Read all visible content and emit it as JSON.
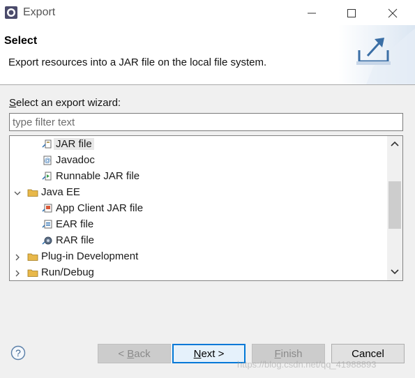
{
  "window": {
    "title": "Export",
    "controls": {
      "minimize_icon": "minimize-icon",
      "maximize_icon": "maximize-icon",
      "close_icon": "close-icon"
    }
  },
  "header": {
    "title": "Select",
    "description": "Export resources into a JAR file on the local file system."
  },
  "wizard": {
    "label_mnemonic": "S",
    "label_rest": "elect an export wizard:",
    "filter_placeholder": "type filter text",
    "filter_value": ""
  },
  "tree": {
    "items": [
      {
        "label": "JAR file",
        "icon": "jar-file-icon",
        "level": 2,
        "expander": "",
        "selected": true
      },
      {
        "label": "Javadoc",
        "icon": "javadoc-icon",
        "level": 2,
        "expander": ""
      },
      {
        "label": "Runnable JAR file",
        "icon": "runnable-jar-icon",
        "level": 2,
        "expander": ""
      },
      {
        "label": "Java EE",
        "icon": "folder-icon",
        "level": 1,
        "expander": "expanded"
      },
      {
        "label": "App Client JAR file",
        "icon": "app-client-jar-icon",
        "level": 2,
        "expander": ""
      },
      {
        "label": "EAR file",
        "icon": "ear-file-icon",
        "level": 2,
        "expander": ""
      },
      {
        "label": "RAR file",
        "icon": "rar-file-icon",
        "level": 2,
        "expander": ""
      },
      {
        "label": "Plug-in Development",
        "icon": "folder-icon",
        "level": 1,
        "expander": "collapsed"
      },
      {
        "label": "Run/Debug",
        "icon": "folder-icon",
        "level": 1,
        "expander": "collapsed"
      }
    ]
  },
  "buttons": {
    "back_prefix": "< ",
    "back_mnemonic": "B",
    "back_rest": "ack",
    "next_mnemonic": "N",
    "next_rest": "ext >",
    "finish_mnemonic": "F",
    "finish_rest": "inish",
    "cancel": "Cancel"
  },
  "watermark": "https://blog.csdn.net/qq_41988893",
  "colors": {
    "accent": "#0078d7",
    "header_bg": "#ffffff",
    "body_bg": "#f0f0f0",
    "folder": "#e8b84a"
  }
}
